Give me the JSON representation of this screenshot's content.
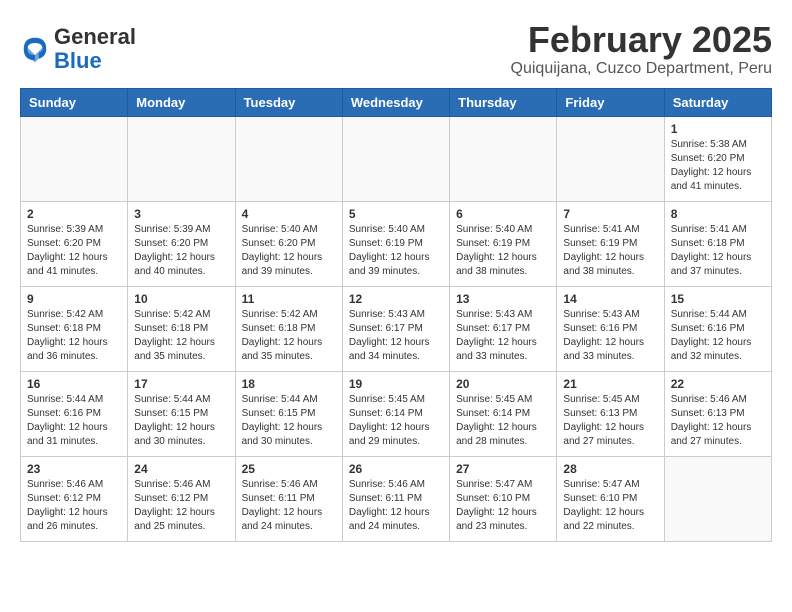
{
  "header": {
    "logo_general": "General",
    "logo_blue": "Blue",
    "month_title": "February 2025",
    "location": "Quiquijana, Cuzco Department, Peru"
  },
  "days_of_week": [
    "Sunday",
    "Monday",
    "Tuesday",
    "Wednesday",
    "Thursday",
    "Friday",
    "Saturday"
  ],
  "weeks": [
    [
      {
        "day": "",
        "info": ""
      },
      {
        "day": "",
        "info": ""
      },
      {
        "day": "",
        "info": ""
      },
      {
        "day": "",
        "info": ""
      },
      {
        "day": "",
        "info": ""
      },
      {
        "day": "",
        "info": ""
      },
      {
        "day": "1",
        "info": "Sunrise: 5:38 AM\nSunset: 6:20 PM\nDaylight: 12 hours\nand 41 minutes."
      }
    ],
    [
      {
        "day": "2",
        "info": "Sunrise: 5:39 AM\nSunset: 6:20 PM\nDaylight: 12 hours\nand 41 minutes."
      },
      {
        "day": "3",
        "info": "Sunrise: 5:39 AM\nSunset: 6:20 PM\nDaylight: 12 hours\nand 40 minutes."
      },
      {
        "day": "4",
        "info": "Sunrise: 5:40 AM\nSunset: 6:20 PM\nDaylight: 12 hours\nand 39 minutes."
      },
      {
        "day": "5",
        "info": "Sunrise: 5:40 AM\nSunset: 6:19 PM\nDaylight: 12 hours\nand 39 minutes."
      },
      {
        "day": "6",
        "info": "Sunrise: 5:40 AM\nSunset: 6:19 PM\nDaylight: 12 hours\nand 38 minutes."
      },
      {
        "day": "7",
        "info": "Sunrise: 5:41 AM\nSunset: 6:19 PM\nDaylight: 12 hours\nand 38 minutes."
      },
      {
        "day": "8",
        "info": "Sunrise: 5:41 AM\nSunset: 6:18 PM\nDaylight: 12 hours\nand 37 minutes."
      }
    ],
    [
      {
        "day": "9",
        "info": "Sunrise: 5:42 AM\nSunset: 6:18 PM\nDaylight: 12 hours\nand 36 minutes."
      },
      {
        "day": "10",
        "info": "Sunrise: 5:42 AM\nSunset: 6:18 PM\nDaylight: 12 hours\nand 35 minutes."
      },
      {
        "day": "11",
        "info": "Sunrise: 5:42 AM\nSunset: 6:18 PM\nDaylight: 12 hours\nand 35 minutes."
      },
      {
        "day": "12",
        "info": "Sunrise: 5:43 AM\nSunset: 6:17 PM\nDaylight: 12 hours\nand 34 minutes."
      },
      {
        "day": "13",
        "info": "Sunrise: 5:43 AM\nSunset: 6:17 PM\nDaylight: 12 hours\nand 33 minutes."
      },
      {
        "day": "14",
        "info": "Sunrise: 5:43 AM\nSunset: 6:16 PM\nDaylight: 12 hours\nand 33 minutes."
      },
      {
        "day": "15",
        "info": "Sunrise: 5:44 AM\nSunset: 6:16 PM\nDaylight: 12 hours\nand 32 minutes."
      }
    ],
    [
      {
        "day": "16",
        "info": "Sunrise: 5:44 AM\nSunset: 6:16 PM\nDaylight: 12 hours\nand 31 minutes."
      },
      {
        "day": "17",
        "info": "Sunrise: 5:44 AM\nSunset: 6:15 PM\nDaylight: 12 hours\nand 30 minutes."
      },
      {
        "day": "18",
        "info": "Sunrise: 5:44 AM\nSunset: 6:15 PM\nDaylight: 12 hours\nand 30 minutes."
      },
      {
        "day": "19",
        "info": "Sunrise: 5:45 AM\nSunset: 6:14 PM\nDaylight: 12 hours\nand 29 minutes."
      },
      {
        "day": "20",
        "info": "Sunrise: 5:45 AM\nSunset: 6:14 PM\nDaylight: 12 hours\nand 28 minutes."
      },
      {
        "day": "21",
        "info": "Sunrise: 5:45 AM\nSunset: 6:13 PM\nDaylight: 12 hours\nand 27 minutes."
      },
      {
        "day": "22",
        "info": "Sunrise: 5:46 AM\nSunset: 6:13 PM\nDaylight: 12 hours\nand 27 minutes."
      }
    ],
    [
      {
        "day": "23",
        "info": "Sunrise: 5:46 AM\nSunset: 6:12 PM\nDaylight: 12 hours\nand 26 minutes."
      },
      {
        "day": "24",
        "info": "Sunrise: 5:46 AM\nSunset: 6:12 PM\nDaylight: 12 hours\nand 25 minutes."
      },
      {
        "day": "25",
        "info": "Sunrise: 5:46 AM\nSunset: 6:11 PM\nDaylight: 12 hours\nand 24 minutes."
      },
      {
        "day": "26",
        "info": "Sunrise: 5:46 AM\nSunset: 6:11 PM\nDaylight: 12 hours\nand 24 minutes."
      },
      {
        "day": "27",
        "info": "Sunrise: 5:47 AM\nSunset: 6:10 PM\nDaylight: 12 hours\nand 23 minutes."
      },
      {
        "day": "28",
        "info": "Sunrise: 5:47 AM\nSunset: 6:10 PM\nDaylight: 12 hours\nand 22 minutes."
      },
      {
        "day": "",
        "info": ""
      }
    ]
  ]
}
